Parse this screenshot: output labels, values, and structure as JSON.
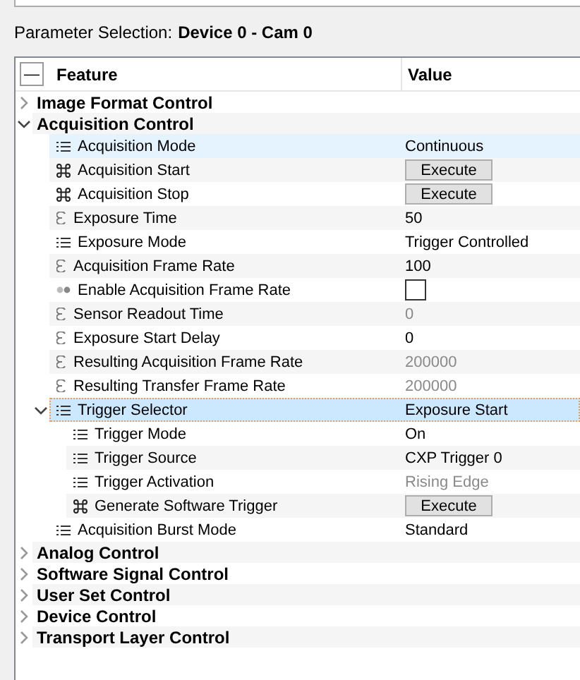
{
  "top_label": "Parameter Selection:",
  "device": "Device 0 - Cam 0",
  "collapse_button": "—",
  "columns": [
    "Feature",
    "Value"
  ],
  "categories": [
    {
      "name": "Image Format Control",
      "expanded": false
    },
    {
      "name": "Acquisition Control",
      "expanded": true,
      "features": [
        {
          "name": "Acquisition Mode",
          "kind": "enumeration",
          "value": "Continuous",
          "disabled": false,
          "selected": false,
          "highlighted": true
        },
        {
          "name": "Acquisition Start",
          "kind": "command",
          "value": "Execute",
          "disabled": false,
          "selected": false,
          "highlighted": false
        },
        {
          "name": "Acquisition Stop",
          "kind": "command",
          "value": "Execute",
          "disabled": false,
          "selected": false,
          "highlighted": false
        },
        {
          "name": "Exposure Time",
          "kind": "float",
          "value": "50",
          "disabled": false,
          "selected": false,
          "highlighted": false
        },
        {
          "name": "Exposure Mode",
          "kind": "enumeration",
          "value": "Trigger Controlled",
          "disabled": false,
          "selected": false,
          "highlighted": false
        },
        {
          "name": "Acquisition Frame Rate",
          "kind": "float",
          "value": "100",
          "disabled": false,
          "selected": false,
          "highlighted": false
        },
        {
          "name": "Enable Acquisition Frame Rate",
          "kind": "boolean",
          "checked": false,
          "disabled": false,
          "selected": false,
          "highlighted": false
        },
        {
          "name": "Sensor Readout Time",
          "kind": "float",
          "value": "0",
          "disabled": true,
          "selected": false,
          "highlighted": false
        },
        {
          "name": "Exposure Start Delay",
          "kind": "float",
          "value": "0",
          "disabled": false,
          "selected": false,
          "highlighted": false
        },
        {
          "name": "Resulting Acquisition Frame Rate",
          "kind": "float",
          "value": "200000",
          "disabled": true,
          "selected": false,
          "highlighted": false
        },
        {
          "name": "Resulting Transfer Frame Rate",
          "kind": "float",
          "value": "200000",
          "disabled": true,
          "selected": false,
          "highlighted": false
        },
        {
          "name": "Trigger Selector",
          "kind": "enumeration",
          "value": "Exposure Start",
          "disabled": false,
          "selected": true,
          "highlighted": false,
          "expanded": true,
          "children": [
            {
              "name": "Trigger Mode",
              "kind": "enumeration",
              "value": "On",
              "disabled": false,
              "selected": false,
              "highlighted": false
            },
            {
              "name": "Trigger Source",
              "kind": "enumeration",
              "value": "CXP Trigger 0",
              "disabled": false,
              "selected": false,
              "highlighted": false
            },
            {
              "name": "Trigger Activation",
              "kind": "enumeration",
              "value": "Rising Edge",
              "disabled": true,
              "selected": false,
              "highlighted": false
            },
            {
              "name": "Generate Software Trigger",
              "kind": "command",
              "value": "Execute",
              "disabled": false,
              "selected": false,
              "highlighted": false
            }
          ]
        },
        {
          "name": "Acquisition Burst Mode",
          "kind": "enumeration",
          "value": "Standard",
          "disabled": false,
          "selected": false,
          "highlighted": false
        }
      ]
    },
    {
      "name": "Analog Control",
      "expanded": false
    },
    {
      "name": "Software Signal Control",
      "expanded": false
    },
    {
      "name": "User Set Control",
      "expanded": false
    },
    {
      "name": "Device Control",
      "expanded": false
    },
    {
      "name": "Transport Layer Control",
      "expanded": false
    }
  ]
}
